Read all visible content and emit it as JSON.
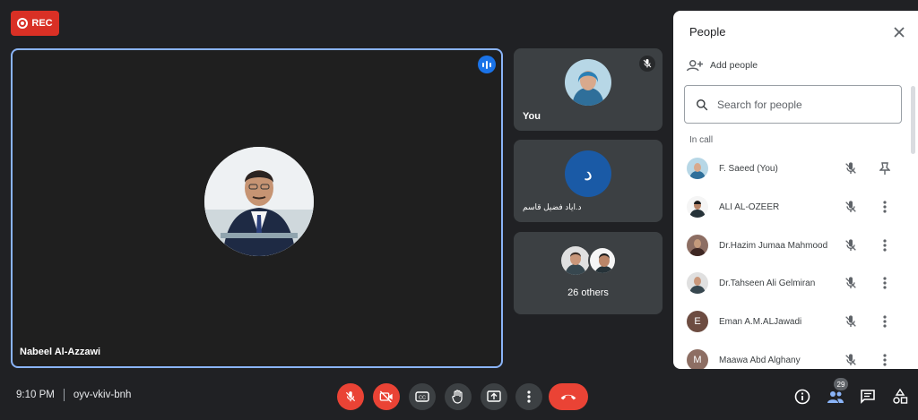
{
  "recording": {
    "label": "REC"
  },
  "main_tile": {
    "name": "Nabeel Al-Azzawi"
  },
  "side_tiles": [
    {
      "name": "You"
    },
    {
      "name": "د.اياد فضيل قاسم",
      "initial": "د"
    },
    {
      "name": "26 others"
    }
  ],
  "people_panel": {
    "title": "People",
    "add_people_label": "Add people",
    "search_placeholder": "Search for people",
    "section_label": "In call",
    "participants": [
      {
        "name": "F. Saeed (You)"
      },
      {
        "name": "ALI AL-OZEER"
      },
      {
        "name": "Dr.Hazim Jumaa Mahmood"
      },
      {
        "name": "Dr.Tahseen Ali Gelmiran"
      },
      {
        "name": "Eman A.M.ALJawadi",
        "initial": "E"
      },
      {
        "name": "Maawa Abd Alghany",
        "initial": "M"
      }
    ]
  },
  "bottom_bar": {
    "time": "9:10 PM",
    "meeting_code": "oyv-vkiv-bnh",
    "participant_count": "29"
  },
  "colors": {
    "accent": "#8ab4f8",
    "danger": "#ea4335",
    "rec": "#d93025",
    "blue": "#1a73e8"
  }
}
